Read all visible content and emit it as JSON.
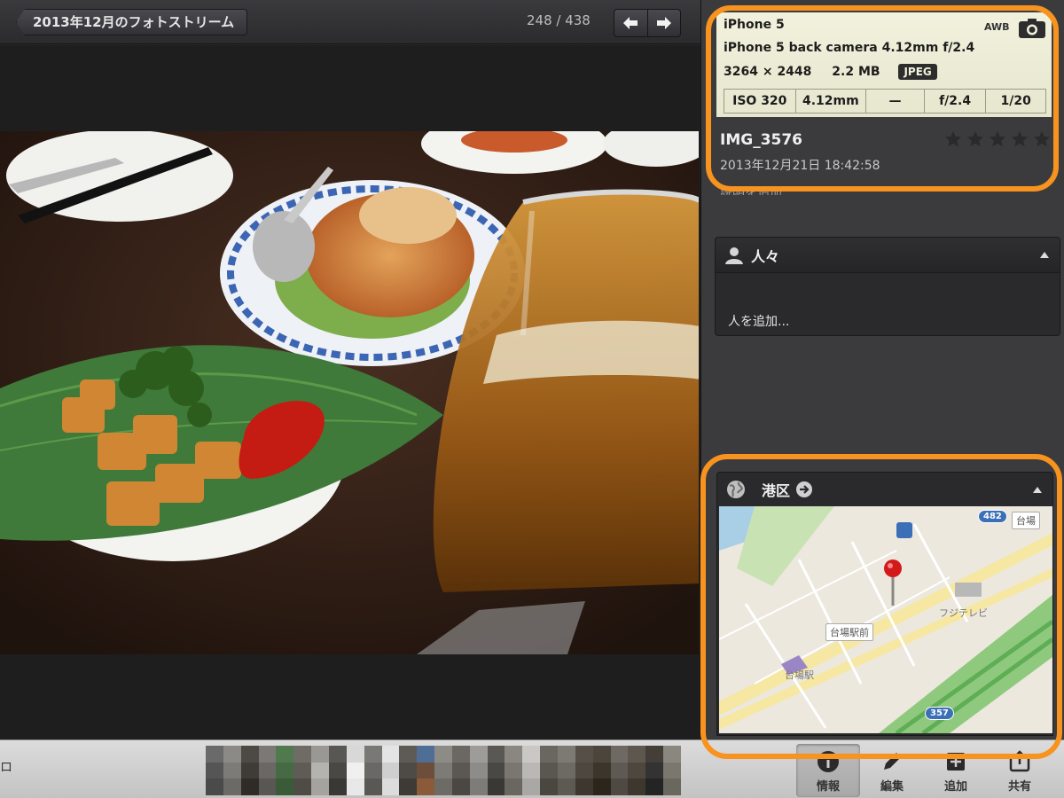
{
  "toolbar": {
    "back_label": "2013年12月のフォトストリーム",
    "counter": "248 / 438"
  },
  "info": {
    "camera_model": "iPhone 5",
    "lens": "iPhone 5 back camera 4.12mm f/2.4",
    "dimensions": "3264 × 2448",
    "file_size": "2.2 MB",
    "format": "JPEG",
    "awb": "AWB",
    "exif": [
      "ISO 320",
      "4.12mm",
      "—",
      "f/2.4",
      "1/20"
    ],
    "image_name": "IMG_3576",
    "date": "2013年12月21日 18:42:58",
    "description_hint": "説明を追加...",
    "rating": 0
  },
  "people": {
    "title": "人々",
    "add_label": "人を追加..."
  },
  "location": {
    "title": "港区",
    "map_labels": {
      "route_482": "482",
      "route_357": "357",
      "daiba": "台場",
      "daiba_station_front": "台場駅前",
      "daiba_station": "台場駅",
      "fuji_tv": "フジテレビ"
    }
  },
  "bottom": {
    "left_glyph": "ロ",
    "tools": [
      "情報",
      "編集",
      "追加",
      "共有"
    ]
  },
  "colors": {
    "highlight": "#f7931e",
    "exif_bg": "#f1f1dd",
    "panel_bg": "#3b3b3e"
  },
  "icons": [
    "arrow-left-icon",
    "arrow-right-icon",
    "camera-icon",
    "star-icon",
    "person-icon",
    "globe-icon",
    "arrow-circle-icon",
    "map-pin-icon",
    "info-icon",
    "pencil-icon",
    "add-icon",
    "share-icon"
  ]
}
